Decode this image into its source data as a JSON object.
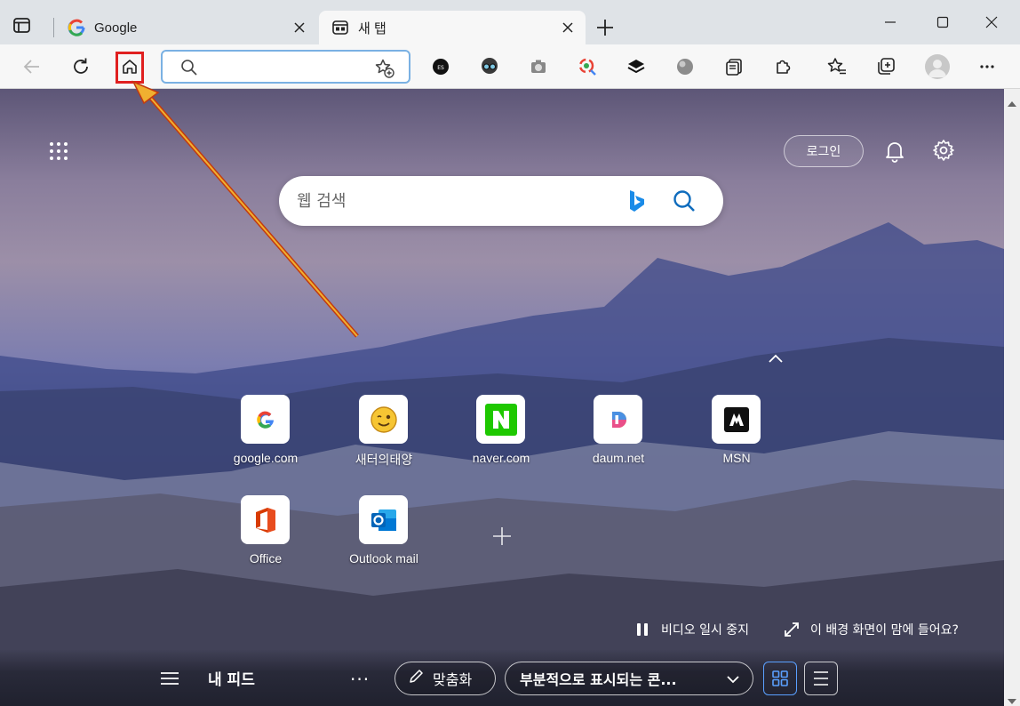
{
  "tabs": [
    {
      "label": "Google",
      "favicon": "google-g-icon",
      "active": false
    },
    {
      "label": "새 탭",
      "favicon": "new-tab-icon",
      "active": true
    }
  ],
  "toolbar": {
    "address_value": "",
    "extension_icons": [
      "es-extension-icon",
      "incognito-glasses-icon",
      "camera-icon",
      "lens-icon",
      "layers-icon",
      "globe-icon",
      "reading-list-icon",
      "extensions-puzzle-icon",
      "favorites-icon",
      "collections-icon",
      "profile-avatar-icon",
      "more-dots-icon"
    ]
  },
  "newtab": {
    "login_label": "로그인",
    "search_placeholder": "웹 검색",
    "tiles": [
      {
        "name": "google.com",
        "icon": "google-g-icon"
      },
      {
        "name": "새터의태양",
        "icon": "winking-smiley-icon"
      },
      {
        "name": "naver.com",
        "icon": "naver-n-icon"
      },
      {
        "name": "daum.net",
        "icon": "daum-d-icon"
      },
      {
        "name": "MSN",
        "icon": "msn-icon"
      },
      {
        "name": "Office",
        "icon": "office-icon"
      },
      {
        "name": "Outlook mail",
        "icon": "outlook-icon"
      }
    ],
    "video_pause_label": "비디오 일시 중지",
    "like_bg_label": "이 배경 화면이 맘에 들어요?"
  },
  "feed": {
    "title": "내 피드",
    "more": "···",
    "customize_label": "맞춤화",
    "display_label": "부분적으로 표시되는 콘..."
  },
  "colors": {
    "highlight_box": "#e02020",
    "arrow": "#e8a020",
    "active_view": "#5aa0ff"
  }
}
